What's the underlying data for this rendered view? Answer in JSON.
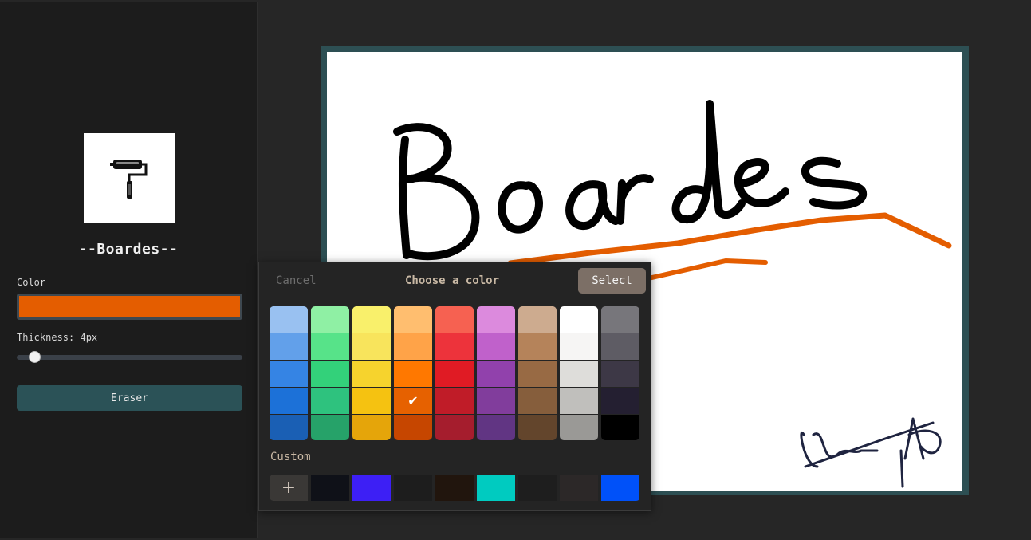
{
  "app": {
    "title": "--Boardes--",
    "logo_icon": "paint-roller-icon"
  },
  "sidebar": {
    "color_label": "Color",
    "current_color": "#e45d00",
    "thickness_label": "Thickness: 4px",
    "thickness": 4,
    "eraser_label": "Eraser"
  },
  "canvas": {
    "handwritten_text": "Boardes",
    "stroke_color": "#000000",
    "underline_color": "#e45d00"
  },
  "color_picker": {
    "cancel_label": "Cancel",
    "title": "Choose a color",
    "select_label": "Select",
    "grid": [
      [
        "#99c1f1",
        "#62a0ea",
        "#3584e4",
        "#1c71d8",
        "#1a5fb4"
      ],
      [
        "#8ff0a4",
        "#57e389",
        "#33d17a",
        "#2ec27e",
        "#26a269"
      ],
      [
        "#f9f06b",
        "#f8e45c",
        "#f6d32d",
        "#f5c211",
        "#e5a50a"
      ],
      [
        "#ffbe6f",
        "#ffa348",
        "#ff7800",
        "#e66100",
        "#c64600"
      ],
      [
        "#f66151",
        "#ed333b",
        "#e01b24",
        "#c01c28",
        "#a51d2d"
      ],
      [
        "#dc8add",
        "#c061cb",
        "#9141ac",
        "#813d9c",
        "#613583"
      ],
      [
        "#cdab8f",
        "#b5835a",
        "#986a44",
        "#865e3c",
        "#63452c"
      ],
      [
        "#ffffff",
        "#f6f5f4",
        "#deddda",
        "#c0bfbc",
        "#9a9996"
      ],
      [
        "#77767b",
        "#5e5c64",
        "#3d3846",
        "#241f31",
        "#000000"
      ]
    ],
    "selected": {
      "column": 3,
      "row": 3
    },
    "custom_label": "Custom",
    "custom_colors": [
      "#0f1118",
      "#3d1ff5",
      "#1d1d1d",
      "#21150d",
      "#00cbc0",
      "#1e1e1e",
      "#2c2828",
      "#0051f9"
    ]
  }
}
